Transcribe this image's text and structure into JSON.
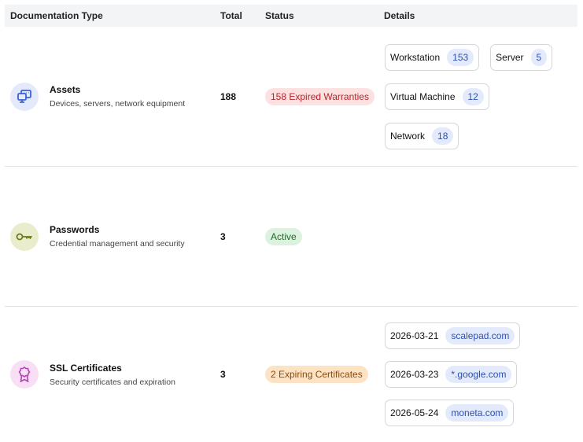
{
  "headers": [
    "Documentation Type",
    "Total",
    "Status",
    "Details"
  ],
  "rows": [
    {
      "name": "Assets",
      "desc": "Devices, servers, network equipment",
      "icon": "monitor-icon",
      "total": "188",
      "status": "158 Expired Warranties",
      "status_bg": "#fde0e0",
      "status_fg": "#b3262d",
      "details": [
        {
          "label": "Workstation",
          "count": "153"
        },
        {
          "label": "Server",
          "count": "5"
        },
        {
          "label": "Virtual Machine",
          "count": "12"
        },
        {
          "label": "Network",
          "count": "18"
        }
      ]
    },
    {
      "name": "Passwords",
      "desc": "Credential management and security",
      "icon": "key-icon",
      "total": "3",
      "status": "Active",
      "status_bg": "#dcf1de",
      "status_fg": "#1f6b2a",
      "details": []
    },
    {
      "name": "SSL Certificates",
      "desc": "Security certificates and expiration",
      "icon": "certificate-icon",
      "total": "3",
      "status": "2 Expiring Certificates",
      "status_bg": "#fde3c4",
      "status_fg": "#8a4a0c",
      "details": [
        {
          "label": "2026-03-21",
          "count": "scalepad.com"
        },
        {
          "label": "2026-03-23",
          "count": "*.google.com"
        },
        {
          "label": "2026-05-24",
          "count": "moneta.com"
        }
      ]
    }
  ]
}
